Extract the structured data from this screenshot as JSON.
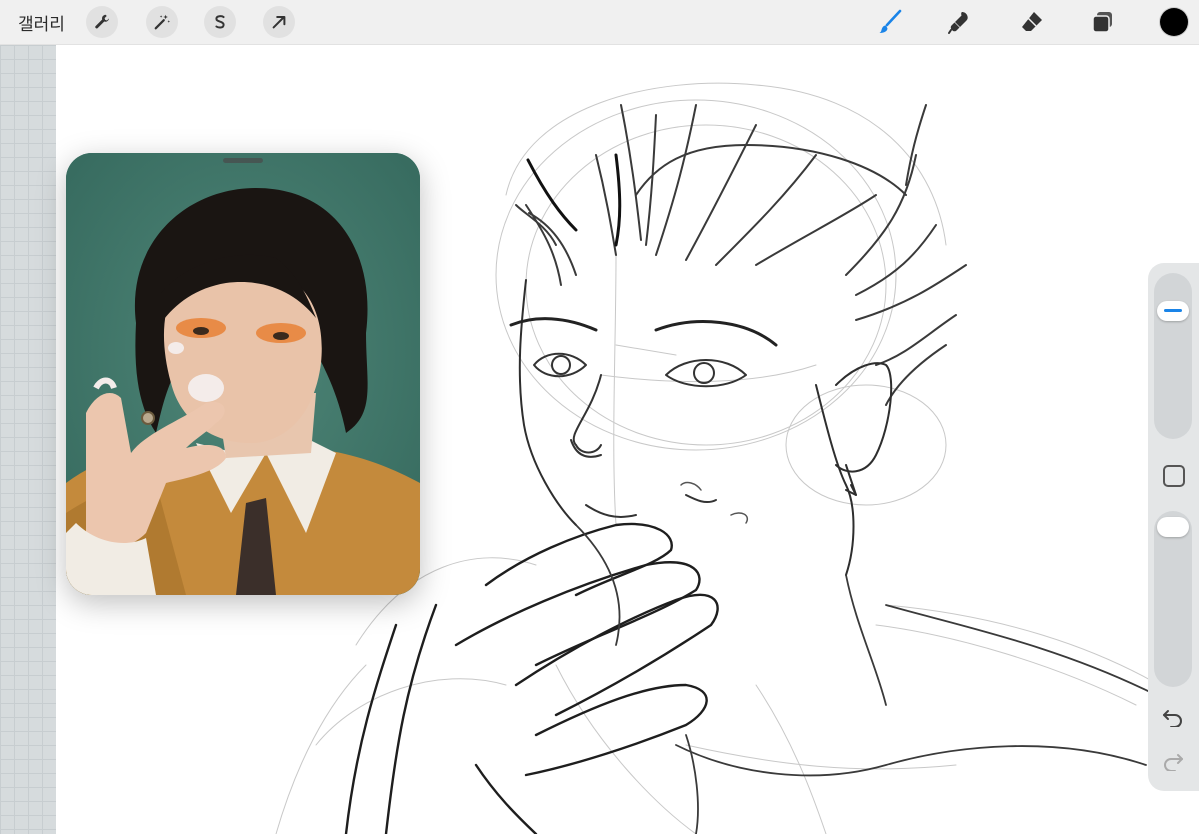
{
  "toolbar": {
    "gallery_label": "갤러리",
    "left_tools": [
      "wrench-icon",
      "magic-wand-icon",
      "selection-s-icon",
      "transform-arrow-icon"
    ],
    "right_tools": [
      "brush-icon",
      "smudge-icon",
      "eraser-icon",
      "layers-icon"
    ],
    "active_tool": "brush-icon",
    "accent_color": "#1a84e8",
    "current_color": "#000000"
  },
  "reference": {
    "photo_background": "#3f7a6c",
    "jacket_color": "#c48a3c"
  },
  "sidebar": {
    "brush_size_level": 0.82,
    "opacity_level": 1.0,
    "icons": [
      "modify-square-icon",
      "undo-icon",
      "redo-icon"
    ]
  }
}
